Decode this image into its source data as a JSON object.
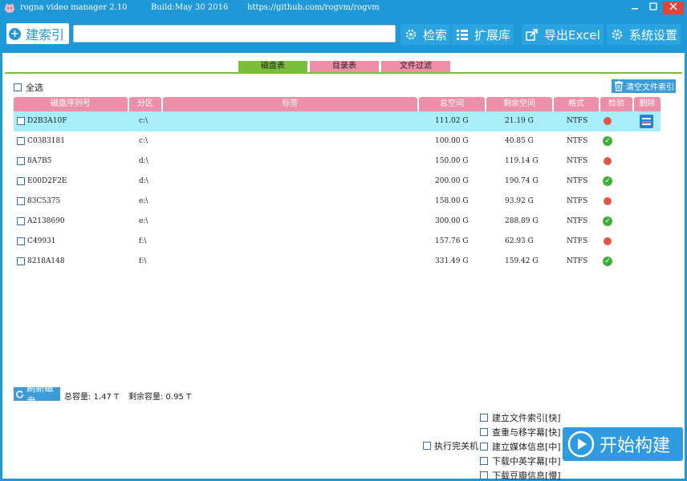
{
  "window": {
    "app_name": "rogna video manager 2.10",
    "build": "Build:May 30 2016",
    "url": "https://github.com/rogvm/rogvm"
  },
  "toolbar": {
    "build_index_label": "建索引",
    "search_value": "",
    "search_label": "检索",
    "extend_label": "扩展库",
    "export_label": "导出Excel",
    "settings_label": "系统设置"
  },
  "tabs": [
    {
      "label": "磁盘表",
      "active": true
    },
    {
      "label": "目录表",
      "active": false
    },
    {
      "label": "文件过滤",
      "active": false
    }
  ],
  "select_all_label": "全选",
  "clear_index_label": "清空文件索引",
  "table": {
    "columns": [
      "磁盘序列号",
      "分区",
      "标签",
      "总空间",
      "剩余空间",
      "格式",
      "检验",
      "删除"
    ],
    "rows": [
      {
        "serial": "D2B3A10F",
        "partition": "c:\\",
        "label": "",
        "total": "111.02 G",
        "free": "21.19 G",
        "format": "NTFS",
        "check": "bad",
        "selected": true
      },
      {
        "serial": "C0383181",
        "partition": "c:\\",
        "label": "",
        "total": "100.00 G",
        "free": "40.85 G",
        "format": "NTFS",
        "check": "ok",
        "selected": false
      },
      {
        "serial": "8A7B5",
        "partition": "d:\\",
        "label": "",
        "total": "150.00 G",
        "free": "119.14 G",
        "format": "NTFS",
        "check": "bad",
        "selected": false
      },
      {
        "serial": "E00D2F2E",
        "partition": "d:\\",
        "label": "",
        "total": "200.00 G",
        "free": "190.74 G",
        "format": "NTFS",
        "check": "ok",
        "selected": false
      },
      {
        "serial": "83C5375",
        "partition": "e:\\",
        "label": "",
        "total": "158.00 G",
        "free": "93.92 G",
        "format": "NTFS",
        "check": "bad",
        "selected": false
      },
      {
        "serial": "A2138690",
        "partition": "e:\\",
        "label": "",
        "total": "300.00 G",
        "free": "288.89 G",
        "format": "NTFS",
        "check": "ok",
        "selected": false
      },
      {
        "serial": "C49931",
        "partition": "f:\\",
        "label": "",
        "total": "157.76 G",
        "free": "62.93 G",
        "format": "NTFS",
        "check": "bad",
        "selected": false
      },
      {
        "serial": "8218A148",
        "partition": "f:\\",
        "label": "",
        "total": "331.49 G",
        "free": "159.42 G",
        "format": "NTFS",
        "check": "ok",
        "selected": false
      }
    ]
  },
  "footer": {
    "refresh_label": "刷新磁盘",
    "total_capacity": "总容量: 1.47 T",
    "free_capacity": "剩余容量: 0.95 T",
    "shutdown_label": "执行完关机",
    "options": [
      "建立文件索引[快]",
      "查重与移字幕[快]",
      "建立媒体信息[中]",
      "下载中英字幕[中]",
      "下载豆瓣信息[慢]"
    ],
    "start_label": "开始构建"
  },
  "colors": {
    "primary": "#1f98d8",
    "pink_header": "#ef8ea9",
    "active_tab": "#79bf3b",
    "selected_row": "#a7eef8",
    "status_ok": "#3dae3a",
    "status_bad": "#e05649"
  },
  "icons": {
    "app": "pig-icon",
    "build": "plus-circle-icon",
    "search": "gear-search-icon",
    "extend": "list-icon",
    "export": "export-icon",
    "settings": "gear-icon",
    "clear": "trash-icon",
    "refresh": "refresh-icon",
    "start": "play-icon",
    "delete": "delete-icon"
  }
}
